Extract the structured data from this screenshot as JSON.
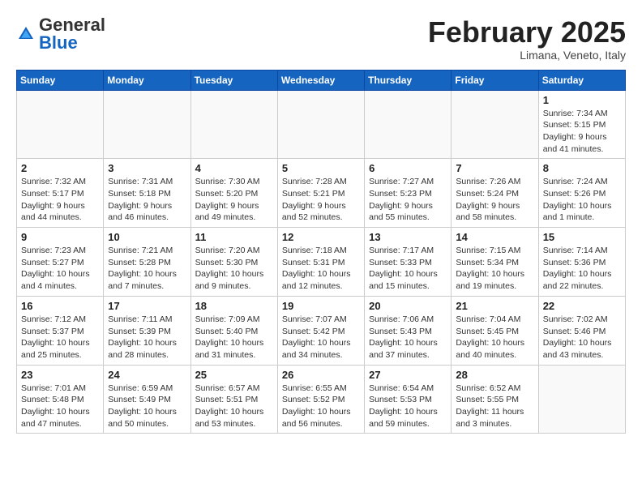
{
  "header": {
    "logo": {
      "general": "General",
      "blue": "Blue"
    },
    "title": "February 2025",
    "subtitle": "Limana, Veneto, Italy"
  },
  "weekdays": [
    "Sunday",
    "Monday",
    "Tuesday",
    "Wednesday",
    "Thursday",
    "Friday",
    "Saturday"
  ],
  "weeks": [
    [
      {
        "day": "",
        "info": ""
      },
      {
        "day": "",
        "info": ""
      },
      {
        "day": "",
        "info": ""
      },
      {
        "day": "",
        "info": ""
      },
      {
        "day": "",
        "info": ""
      },
      {
        "day": "",
        "info": ""
      },
      {
        "day": "1",
        "info": "Sunrise: 7:34 AM\nSunset: 5:15 PM\nDaylight: 9 hours and 41 minutes."
      }
    ],
    [
      {
        "day": "2",
        "info": "Sunrise: 7:32 AM\nSunset: 5:17 PM\nDaylight: 9 hours and 44 minutes."
      },
      {
        "day": "3",
        "info": "Sunrise: 7:31 AM\nSunset: 5:18 PM\nDaylight: 9 hours and 46 minutes."
      },
      {
        "day": "4",
        "info": "Sunrise: 7:30 AM\nSunset: 5:20 PM\nDaylight: 9 hours and 49 minutes."
      },
      {
        "day": "5",
        "info": "Sunrise: 7:28 AM\nSunset: 5:21 PM\nDaylight: 9 hours and 52 minutes."
      },
      {
        "day": "6",
        "info": "Sunrise: 7:27 AM\nSunset: 5:23 PM\nDaylight: 9 hours and 55 minutes."
      },
      {
        "day": "7",
        "info": "Sunrise: 7:26 AM\nSunset: 5:24 PM\nDaylight: 9 hours and 58 minutes."
      },
      {
        "day": "8",
        "info": "Sunrise: 7:24 AM\nSunset: 5:26 PM\nDaylight: 10 hours and 1 minute."
      }
    ],
    [
      {
        "day": "9",
        "info": "Sunrise: 7:23 AM\nSunset: 5:27 PM\nDaylight: 10 hours and 4 minutes."
      },
      {
        "day": "10",
        "info": "Sunrise: 7:21 AM\nSunset: 5:28 PM\nDaylight: 10 hours and 7 minutes."
      },
      {
        "day": "11",
        "info": "Sunrise: 7:20 AM\nSunset: 5:30 PM\nDaylight: 10 hours and 9 minutes."
      },
      {
        "day": "12",
        "info": "Sunrise: 7:18 AM\nSunset: 5:31 PM\nDaylight: 10 hours and 12 minutes."
      },
      {
        "day": "13",
        "info": "Sunrise: 7:17 AM\nSunset: 5:33 PM\nDaylight: 10 hours and 15 minutes."
      },
      {
        "day": "14",
        "info": "Sunrise: 7:15 AM\nSunset: 5:34 PM\nDaylight: 10 hours and 19 minutes."
      },
      {
        "day": "15",
        "info": "Sunrise: 7:14 AM\nSunset: 5:36 PM\nDaylight: 10 hours and 22 minutes."
      }
    ],
    [
      {
        "day": "16",
        "info": "Sunrise: 7:12 AM\nSunset: 5:37 PM\nDaylight: 10 hours and 25 minutes."
      },
      {
        "day": "17",
        "info": "Sunrise: 7:11 AM\nSunset: 5:39 PM\nDaylight: 10 hours and 28 minutes."
      },
      {
        "day": "18",
        "info": "Sunrise: 7:09 AM\nSunset: 5:40 PM\nDaylight: 10 hours and 31 minutes."
      },
      {
        "day": "19",
        "info": "Sunrise: 7:07 AM\nSunset: 5:42 PM\nDaylight: 10 hours and 34 minutes."
      },
      {
        "day": "20",
        "info": "Sunrise: 7:06 AM\nSunset: 5:43 PM\nDaylight: 10 hours and 37 minutes."
      },
      {
        "day": "21",
        "info": "Sunrise: 7:04 AM\nSunset: 5:45 PM\nDaylight: 10 hours and 40 minutes."
      },
      {
        "day": "22",
        "info": "Sunrise: 7:02 AM\nSunset: 5:46 PM\nDaylight: 10 hours and 43 minutes."
      }
    ],
    [
      {
        "day": "23",
        "info": "Sunrise: 7:01 AM\nSunset: 5:48 PM\nDaylight: 10 hours and 47 minutes."
      },
      {
        "day": "24",
        "info": "Sunrise: 6:59 AM\nSunset: 5:49 PM\nDaylight: 10 hours and 50 minutes."
      },
      {
        "day": "25",
        "info": "Sunrise: 6:57 AM\nSunset: 5:51 PM\nDaylight: 10 hours and 53 minutes."
      },
      {
        "day": "26",
        "info": "Sunrise: 6:55 AM\nSunset: 5:52 PM\nDaylight: 10 hours and 56 minutes."
      },
      {
        "day": "27",
        "info": "Sunrise: 6:54 AM\nSunset: 5:53 PM\nDaylight: 10 hours and 59 minutes."
      },
      {
        "day": "28",
        "info": "Sunrise: 6:52 AM\nSunset: 5:55 PM\nDaylight: 11 hours and 3 minutes."
      },
      {
        "day": "",
        "info": ""
      }
    ]
  ]
}
